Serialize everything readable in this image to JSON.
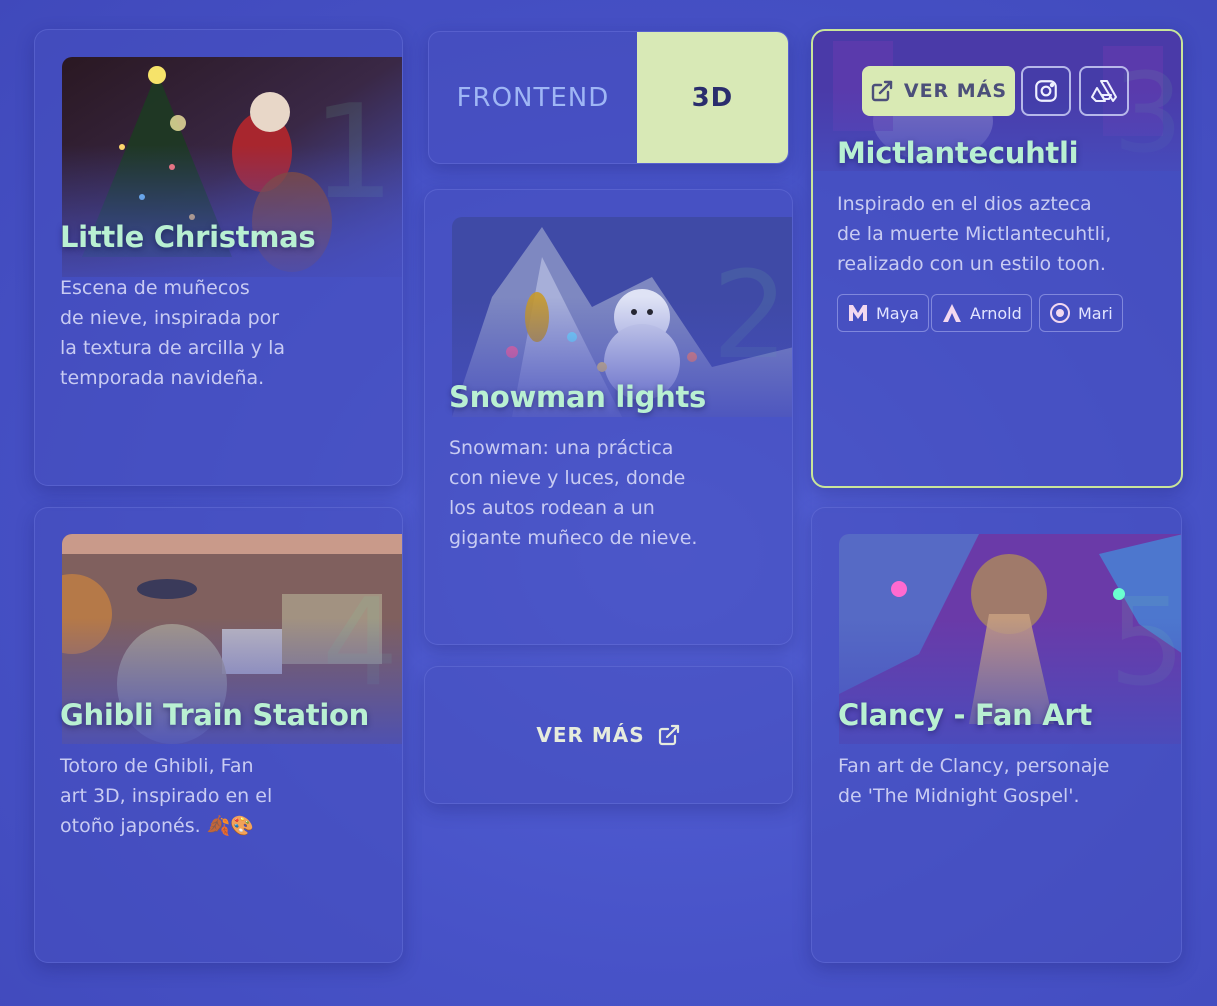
{
  "toggle": {
    "frontend_label": "FRONTEND",
    "active_label": "3D"
  },
  "colors": {
    "background": "#4a55c9",
    "title_accent": "#b9f0d2",
    "active_toggle": "#d8e9b6",
    "highlight_border": "#c9e59a"
  },
  "projects": [
    {
      "title": "Little Christmas",
      "description": "Escena de muñecos de nieve, inspirada por la textura de arcilla y la temporada navideña.",
      "desc_lines": [
        "Escena de muñecos",
        "de nieve, inspirada por",
        "la textura de arcilla y la",
        "temporada navideña."
      ]
    },
    {
      "title": "Snowman lights",
      "description": "Snowman: una práctica con nieve y luces, donde los autos rodean a un gigante muñeco de nieve.",
      "desc_lines": [
        "Snowman: una práctica",
        "con nieve y luces, donde",
        "los autos rodean a un",
        "gigante muñeco de nieve."
      ]
    },
    {
      "title": "Mictlantecuhtli",
      "description": "Inspirado en el dios azteca de la muerte Mictlantecuhtli, realizado con un estilo toon.",
      "desc_lines": [
        "Inspirado en el dios azteca",
        "de la muerte Mictlantecuhtli,",
        "realizado con un estilo toon."
      ],
      "ver_mas_label": "VER MÁS",
      "tags": [
        "Maya",
        "Arnold",
        "Mari"
      ]
    },
    {
      "title": "Ghibli Train Station",
      "description": "Totoro de Ghibli, Fan art 3D, inspirado en el otoño japonés. 🍂🎨",
      "desc_lines": [
        "Totoro de Ghibli, Fan",
        "art 3D, inspirado en el",
        "otoño japonés. 🍂🎨"
      ]
    },
    {
      "title": "Clancy - Fan Art",
      "description": "Fan art de Clancy, personaje de 'The Midnight Gospel'.",
      "desc_lines": [
        "Fan art de Clancy, personaje",
        "de 'The Midnight Gospel'."
      ]
    }
  ],
  "more_button": {
    "label": "VER MÁS"
  },
  "icons": [
    "external-link-icon",
    "instagram-icon",
    "artstation-icon",
    "maya-icon",
    "arnold-icon",
    "mari-icon"
  ]
}
